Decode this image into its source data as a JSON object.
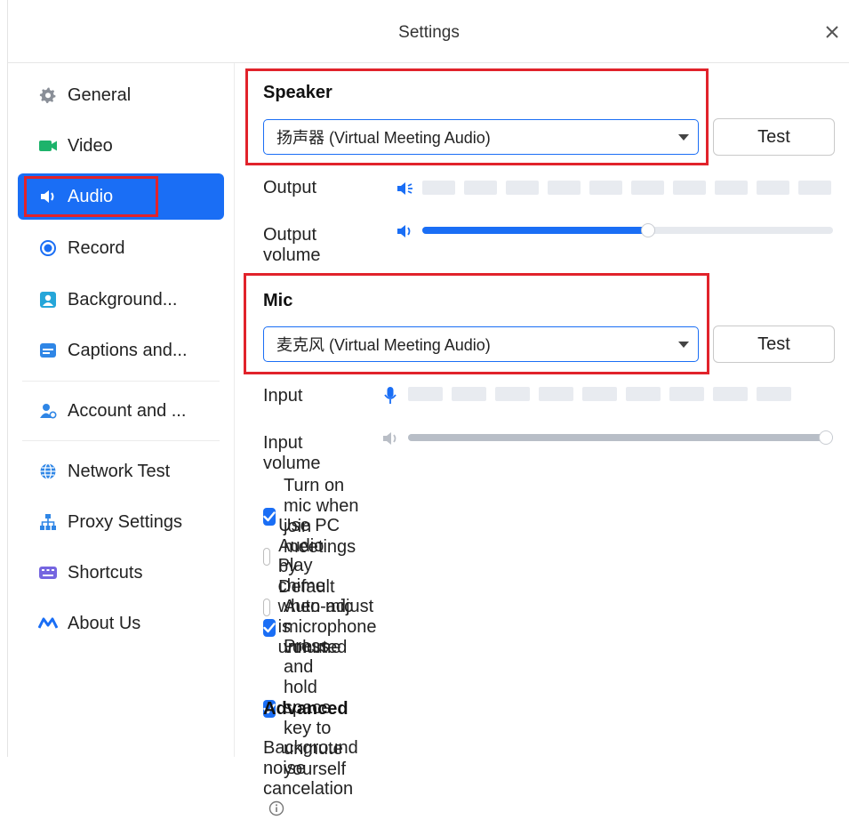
{
  "window": {
    "title": "Settings"
  },
  "sidebar": {
    "items": [
      {
        "label": "General",
        "icon": "gear-icon",
        "active": false
      },
      {
        "label": "Video",
        "icon": "video-camera-icon",
        "active": false
      },
      {
        "label": "Audio",
        "icon": "speaker-icon",
        "active": true
      },
      {
        "label": "Record",
        "icon": "record-icon",
        "active": false
      },
      {
        "label": "Background...",
        "icon": "portrait-icon",
        "active": false
      },
      {
        "label": "Captions and...",
        "icon": "captions-icon",
        "active": false
      },
      {
        "label": "Account and ...",
        "icon": "account-icon",
        "active": false
      },
      {
        "label": "Network Test",
        "icon": "globe-icon",
        "active": false
      },
      {
        "label": "Proxy Settings",
        "icon": "network-tree-icon",
        "active": false
      },
      {
        "label": "Shortcuts",
        "icon": "keyboard-icon",
        "active": false
      },
      {
        "label": "About Us",
        "icon": "logo-icon",
        "active": false
      }
    ]
  },
  "speaker": {
    "title": "Speaker",
    "device": "扬声器 (Virtual Meeting Audio)",
    "test_label": "Test",
    "output_label": "Output",
    "output_volume_label": "Output volume",
    "output_volume": 0.55
  },
  "mic": {
    "title": "Mic",
    "device": "麦克风 (Virtual Meeting Audio)",
    "test_label": "Test",
    "input_label": "Input",
    "input_volume_label": "Input volume",
    "input_volume": 1.0
  },
  "options": [
    {
      "label": "Turn on mic when join meetings",
      "checked": true
    },
    {
      "label": "Use PC Audio by Default",
      "checked": false
    },
    {
      "label": "Play chime when mic is unmuted",
      "checked": false
    },
    {
      "label": "Auto-adjust microphone volume",
      "checked": true
    },
    {
      "label": "Press and hold space key to unmute yourself",
      "checked": true
    }
  ],
  "advanced": {
    "title": "Advanced",
    "noise_label": "Background noise cancelation"
  },
  "colors": {
    "accent": "#1a6ef5",
    "highlight_box": "#e1232b"
  }
}
